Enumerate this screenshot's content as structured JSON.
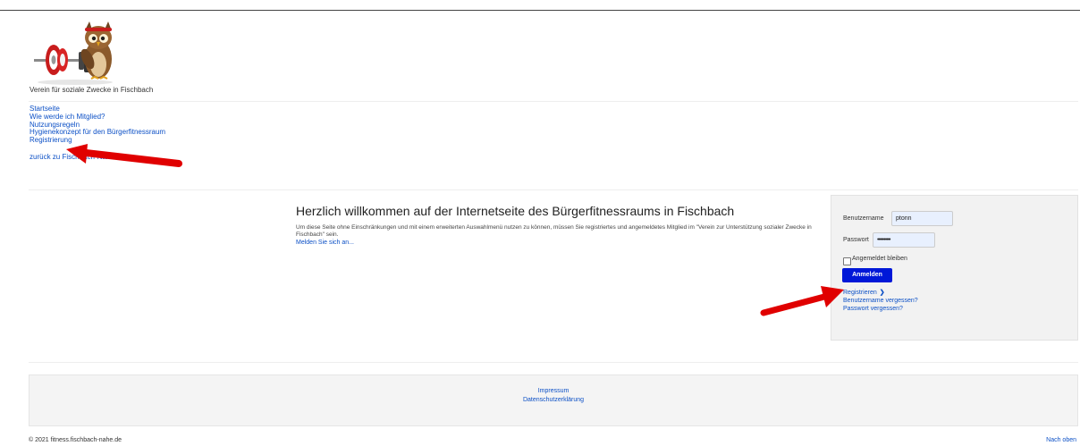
{
  "header": {
    "site_name": "Verein für soziale Zwecke in Fischbach"
  },
  "nav": {
    "items": [
      {
        "label": "Startseite"
      },
      {
        "label": "Wie werde ich Mitglied?"
      },
      {
        "label": "Nutzungsregeln"
      },
      {
        "label": "Hygienekonzept für den Bürgerfitnessraum"
      },
      {
        "label": "Registrierung"
      }
    ],
    "back_link": "zurück zu Fischbach-Nahe.de"
  },
  "main": {
    "title": "Herzlich willkommen auf der Internetseite des Bürgerfitnessraums in Fischbach",
    "text": "Um diese Seite ohne Einschränkungen und mit einem erweiterten Auswahlmenü nutzen zu können, müssen Sie registriertes und angemeldetes Mitglied im \"Verein zur Unterstützung sozialer Zwecke in Fischbach\" sein.",
    "login_link": "Melden Sie sich an..."
  },
  "login": {
    "username_label": "Benutzername",
    "username_value": "ptonn",
    "password_label": "Passwort",
    "password_value": "••••••••••",
    "remember_label": "Angemeldet bleiben",
    "submit_label": "Anmelden",
    "register_link": "Registrieren",
    "forgot_username": "Benutzername vergessen?",
    "forgot_password": "Passwort vergessen?"
  },
  "footer": {
    "impressum": "Impressum",
    "datenschutz": "Datenschutzerklärung",
    "copyright": "© 2021 fitness.fischbach-nahe.de",
    "back_to_top": "Nach oben"
  },
  "colors": {
    "link": "#0c50c6",
    "button": "#0018d8",
    "annotation_arrow": "#e00000"
  }
}
